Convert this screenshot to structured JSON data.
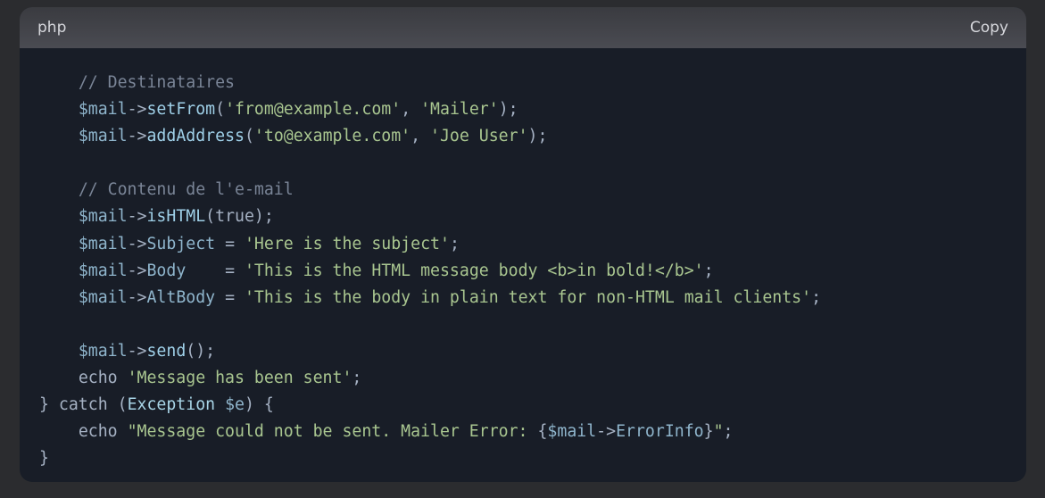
{
  "header": {
    "language": "php",
    "copy_label": "Copy"
  },
  "code": {
    "lines": [
      [
        {
          "t": "    "
        },
        {
          "t": "// Destinataires",
          "c": "comment"
        }
      ],
      [
        {
          "t": "    "
        },
        {
          "t": "$mail",
          "c": "var"
        },
        {
          "t": "->",
          "c": "op"
        },
        {
          "t": "setFrom",
          "c": "func"
        },
        {
          "t": "(",
          "c": "punct"
        },
        {
          "t": "'from@example.com'",
          "c": "str"
        },
        {
          "t": ", ",
          "c": "punct"
        },
        {
          "t": "'Mailer'",
          "c": "str"
        },
        {
          "t": ");",
          "c": "punct"
        }
      ],
      [
        {
          "t": "    "
        },
        {
          "t": "$mail",
          "c": "var"
        },
        {
          "t": "->",
          "c": "op"
        },
        {
          "t": "addAddress",
          "c": "func"
        },
        {
          "t": "(",
          "c": "punct"
        },
        {
          "t": "'to@example.com'",
          "c": "str"
        },
        {
          "t": ", ",
          "c": "punct"
        },
        {
          "t": "'Joe User'",
          "c": "str"
        },
        {
          "t": ");",
          "c": "punct"
        }
      ],
      [],
      [
        {
          "t": "    "
        },
        {
          "t": "// Contenu de l'e-mail",
          "c": "comment"
        }
      ],
      [
        {
          "t": "    "
        },
        {
          "t": "$mail",
          "c": "var"
        },
        {
          "t": "->",
          "c": "op"
        },
        {
          "t": "isHTML",
          "c": "func"
        },
        {
          "t": "(true);",
          "c": "punct"
        }
      ],
      [
        {
          "t": "    "
        },
        {
          "t": "$mail",
          "c": "var"
        },
        {
          "t": "->",
          "c": "op"
        },
        {
          "t": "Subject",
          "c": "var"
        },
        {
          "t": " = ",
          "c": "op"
        },
        {
          "t": "'Here is the subject'",
          "c": "str"
        },
        {
          "t": ";",
          "c": "punct"
        }
      ],
      [
        {
          "t": "    "
        },
        {
          "t": "$mail",
          "c": "var"
        },
        {
          "t": "->",
          "c": "op"
        },
        {
          "t": "Body",
          "c": "var"
        },
        {
          "t": "    = ",
          "c": "op"
        },
        {
          "t": "'This is the HTML message body <b>in bold!</b>'",
          "c": "str"
        },
        {
          "t": ";",
          "c": "punct"
        }
      ],
      [
        {
          "t": "    "
        },
        {
          "t": "$mail",
          "c": "var"
        },
        {
          "t": "->",
          "c": "op"
        },
        {
          "t": "AltBody",
          "c": "var"
        },
        {
          "t": " = ",
          "c": "op"
        },
        {
          "t": "'This is the body in plain text for non-HTML mail clients'",
          "c": "str"
        },
        {
          "t": ";",
          "c": "punct"
        }
      ],
      [],
      [
        {
          "t": "    "
        },
        {
          "t": "$mail",
          "c": "var"
        },
        {
          "t": "->",
          "c": "op"
        },
        {
          "t": "send",
          "c": "func"
        },
        {
          "t": "();",
          "c": "punct"
        }
      ],
      [
        {
          "t": "    "
        },
        {
          "t": "echo ",
          "c": "kw"
        },
        {
          "t": "'Message has been sent'",
          "c": "str"
        },
        {
          "t": ";",
          "c": "punct"
        }
      ],
      [
        {
          "t": "} catch (",
          "c": "kw"
        },
        {
          "t": "Exception",
          "c": "class"
        },
        {
          "t": " ",
          "c": "punct"
        },
        {
          "t": "$e",
          "c": "var"
        },
        {
          "t": ") {",
          "c": "punct"
        }
      ],
      [
        {
          "t": "    "
        },
        {
          "t": "echo ",
          "c": "kw"
        },
        {
          "t": "\"Message could not be sent. Mailer Error: ",
          "c": "str"
        },
        {
          "t": "{",
          "c": "punct"
        },
        {
          "t": "$mail",
          "c": "var"
        },
        {
          "t": "->",
          "c": "op"
        },
        {
          "t": "ErrorInfo",
          "c": "var"
        },
        {
          "t": "}",
          "c": "punct"
        },
        {
          "t": "\"",
          "c": "str"
        },
        {
          "t": ";",
          "c": "punct"
        }
      ],
      [
        {
          "t": "}",
          "c": "punct"
        }
      ]
    ]
  },
  "colors": {
    "background": "#181d27",
    "header_bg": "#45464c",
    "comment": "#7a8597",
    "string": "#a9c690",
    "variable": "#8fb5cc"
  }
}
